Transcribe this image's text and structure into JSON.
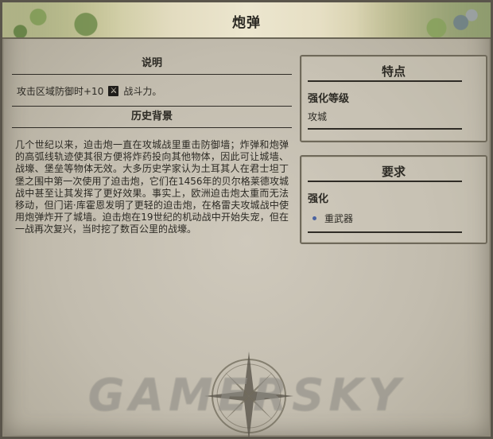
{
  "window": {
    "title": "炮弹",
    "close_icon": "close-icon"
  },
  "description": {
    "header": "说明",
    "text_before": "攻击区域防御时+10",
    "icon": "strength-icon",
    "text_after": "战斗力。"
  },
  "history": {
    "header": "历史背景",
    "body": "几个世纪以来，迫击炮一直在攻城战里重击防御墙；炸弹和炮弹的高弧线轨迹使其很方便将炸药投向其他物体，因此可让城墙、战壕、堡垒等物体无效。大多历史学家认为土耳其人在君士坦丁堡之围中第一次使用了迫击炮，它们在1456年的贝尔格莱德攻城战中甚至让其发挥了更好效果。事实上，欧洲迫击炮太重而无法移动，但门诺·库霍恩发明了更轻的迫击炮，在格雷夫攻城战中使用炮弹炸开了城墙。迫击炮在19世纪的机动战中开始失宠，但在一战再次复兴，当时挖了数百公里的战壕。"
  },
  "traits": {
    "header": "特点",
    "label": "强化等级",
    "value": "攻城"
  },
  "requirements": {
    "header": "要求",
    "label": "强化",
    "items": [
      "重武器"
    ]
  },
  "watermark": "GAMERSKY",
  "colors": {
    "parchment": "#c5bfb1",
    "text": "#2c2a24",
    "bullet": "#4b63a0"
  }
}
